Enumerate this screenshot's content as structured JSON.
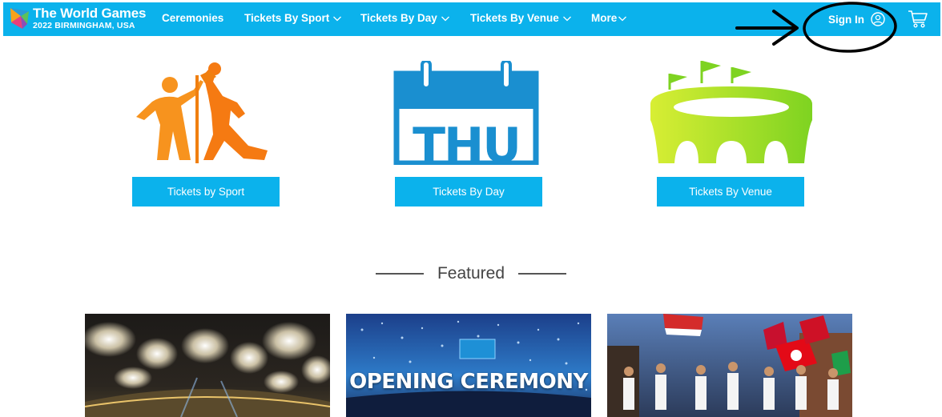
{
  "brand": {
    "title": "The World Games",
    "subtitle": "2022 BIRMINGHAM, USA"
  },
  "nav": {
    "items": [
      {
        "label": "Ceremonies",
        "has_dropdown": false
      },
      {
        "label": "Tickets By Sport",
        "has_dropdown": true
      },
      {
        "label": "Tickets By Day",
        "has_dropdown": true
      },
      {
        "label": "Tickets By Venue",
        "has_dropdown": true
      },
      {
        "label": "More",
        "has_dropdown": true
      }
    ],
    "sign_in_label": "Sign In",
    "icons": [
      "user-circle-icon",
      "shopping-cart-icon"
    ]
  },
  "categories": [
    {
      "button_label": "Tickets by Sport",
      "icon": "athletes-high-five-icon"
    },
    {
      "button_label": "Tickets By Day",
      "icon": "calendar-icon",
      "icon_text": "THU"
    },
    {
      "button_label": "Tickets By Venue",
      "icon": "stadium-icon"
    }
  ],
  "featured": {
    "title": "Featured",
    "cards": [
      {
        "caption": "",
        "image": "fireworks-stadium-photo"
      },
      {
        "caption": "OPENING CEREMONY",
        "image": "opening-ceremony-photo"
      },
      {
        "caption": "",
        "image": "flag-parade-photo"
      }
    ]
  },
  "annotation": {
    "type": "arrow-and-circle",
    "target": "sign-in"
  },
  "colors": {
    "nav_bg": "#0bb2ec",
    "button_bg": "#0bb2ec",
    "sport_orange": "#f57c12",
    "calendar_blue": "#1a8fd0",
    "stadium_green": "#8bd42a"
  }
}
